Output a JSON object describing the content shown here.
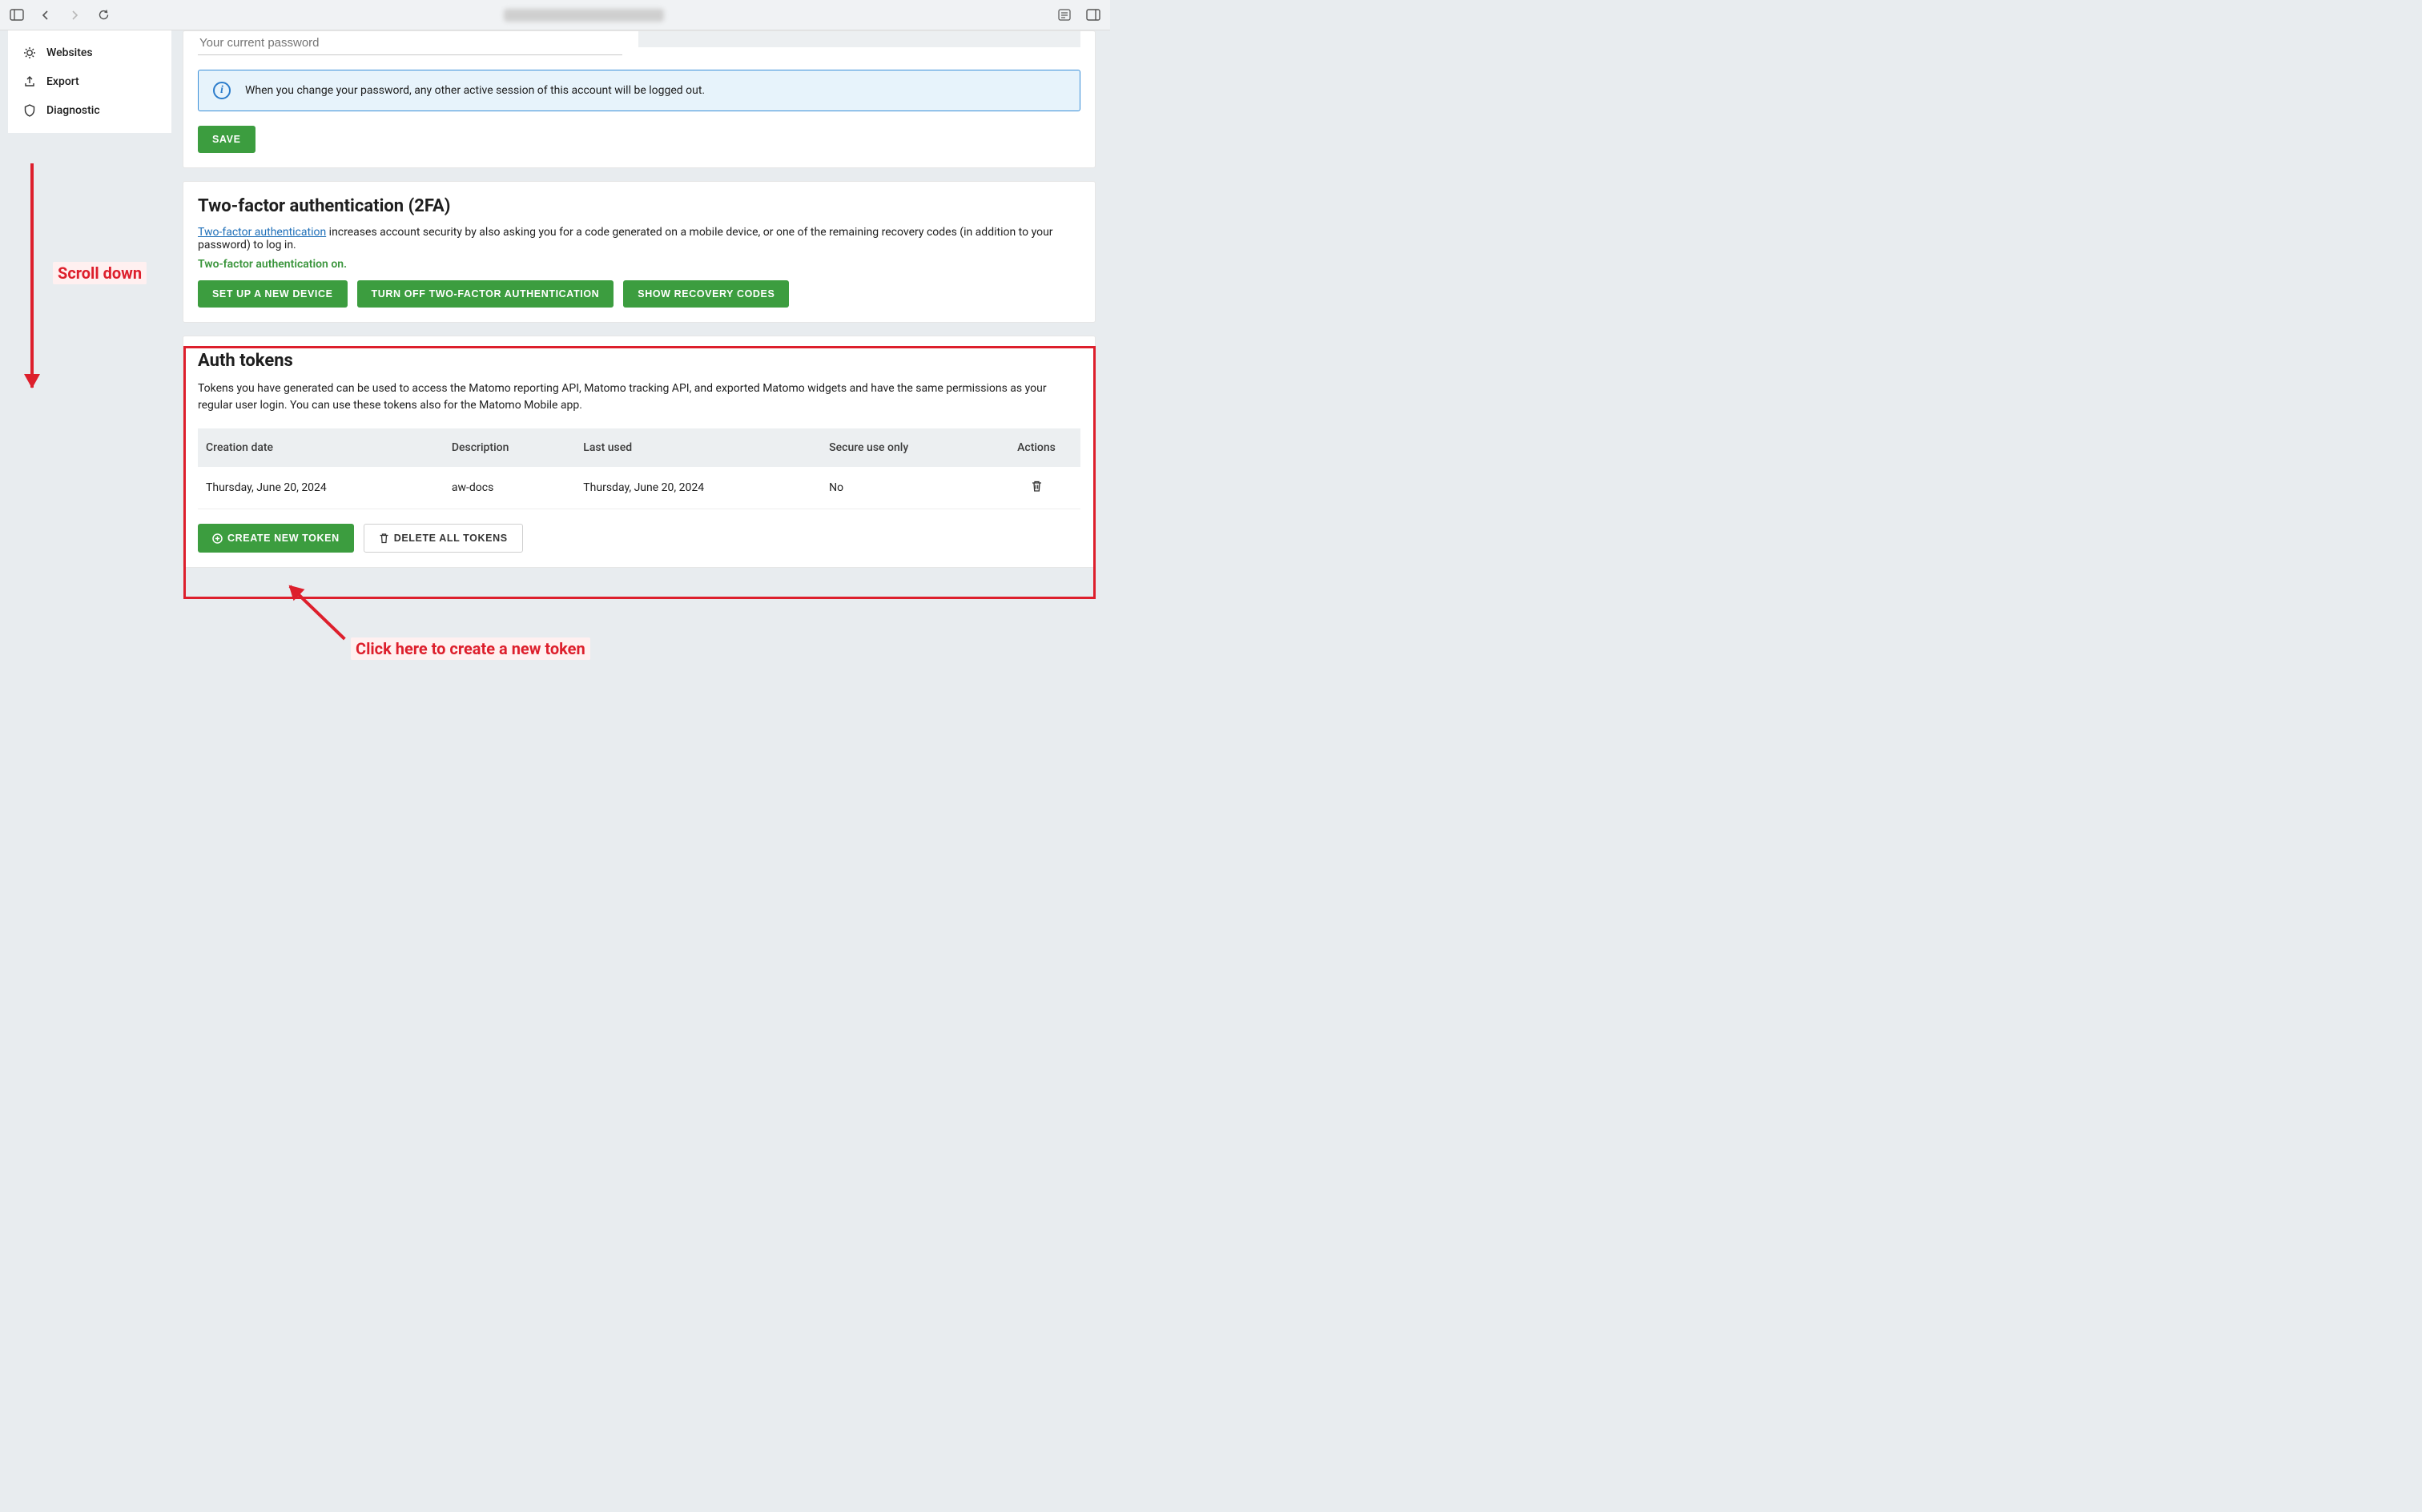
{
  "browser": {
    "url_blurred": true
  },
  "sidebar": {
    "items": [
      {
        "label": "Websites",
        "id": "websites"
      },
      {
        "label": "Export",
        "id": "export"
      },
      {
        "label": "Diagnostic",
        "id": "diagnostic"
      }
    ]
  },
  "password_section": {
    "placeholder": "Your current password",
    "info_text": "When you change your password, any other active session of this account will be logged out.",
    "save_label": "SAVE"
  },
  "twofa_section": {
    "title": "Two-factor authentication (2FA)",
    "link_label": "Two-factor authentication",
    "desc_rest": " increases account security by also asking you for a code generated on a mobile device, or one of the remaining recovery codes (in addition to your password) to log in.",
    "on_text": "Two-factor authentication on.",
    "btn_setup": "SET UP A NEW DEVICE",
    "btn_turnoff": "TURN OFF TWO-FACTOR AUTHENTICATION",
    "btn_recovery": "SHOW RECOVERY CODES"
  },
  "tokens_section": {
    "title": "Auth tokens",
    "desc": "Tokens you have generated can be used to access the Matomo reporting API, Matomo tracking API, and exported Matomo widgets and have the same permissions as your regular user login. You can use these tokens also for the Matomo Mobile app.",
    "columns": {
      "creation": "Creation date",
      "description": "Description",
      "last_used": "Last used",
      "secure": "Secure use only",
      "actions": "Actions"
    },
    "rows": [
      {
        "creation": "Thursday, June 20, 2024",
        "description": "aw-docs",
        "last_used": "Thursday, June 20, 2024",
        "secure": "No"
      }
    ],
    "btn_create": "CREATE NEW TOKEN",
    "btn_delete_all": "DELETE ALL TOKENS"
  },
  "annotations": {
    "scroll_down": "Scroll down",
    "click_here": "Click here to create a new token"
  }
}
